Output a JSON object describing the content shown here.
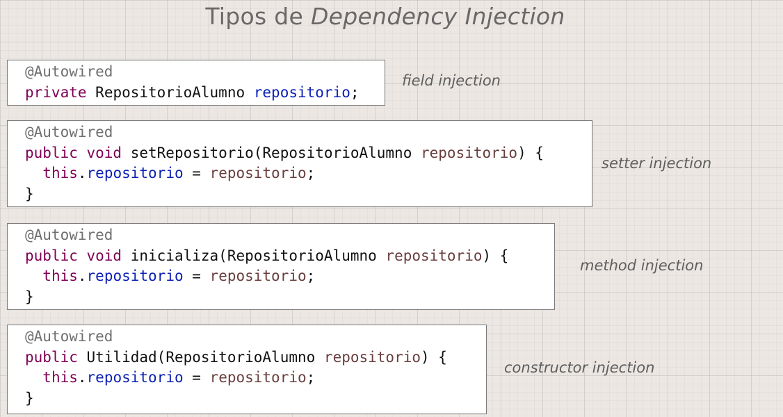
{
  "title": {
    "prefix": "Tipos de ",
    "emphasis": "Dependency Injection"
  },
  "blocks": [
    {
      "label": "field injection",
      "annotation": "@Autowired",
      "modifier": "private",
      "type": "RepositorioAlumno",
      "name": "repositorio",
      "terminator": ";"
    },
    {
      "label": "setter injection",
      "annotation": "@Autowired",
      "modifiers": "public void",
      "method": "setRepositorio",
      "param_type": "RepositorioAlumno",
      "param_name": "repositorio",
      "open": ") {",
      "this_kw": "this",
      "field": "repositorio",
      "assign": " = ",
      "value": "repositorio",
      "end": ";",
      "close": "}"
    },
    {
      "label": "method injection",
      "annotation": "@Autowired",
      "modifiers": "public void",
      "method": "inicializa",
      "param_type": "RepositorioAlumno",
      "param_name": "repositorio",
      "open": ") {",
      "this_kw": "this",
      "field": "repositorio",
      "assign": " = ",
      "value": "repositorio",
      "end": ";",
      "close": "}"
    },
    {
      "label": "constructor injection",
      "annotation": "@Autowired",
      "modifiers": "public",
      "method": "Utilidad",
      "param_type": "RepositorioAlumno",
      "param_name": "repositorio",
      "open": ") {",
      "this_kw": "this",
      "field": "repositorio",
      "assign": " = ",
      "value": "repositorio",
      "end": ";",
      "close": "}"
    }
  ],
  "colors": {
    "annotation": "#6f6f6f",
    "keyword": "#7f0055",
    "field": "#0a1fb5",
    "parameter": "#6a3e3e"
  }
}
